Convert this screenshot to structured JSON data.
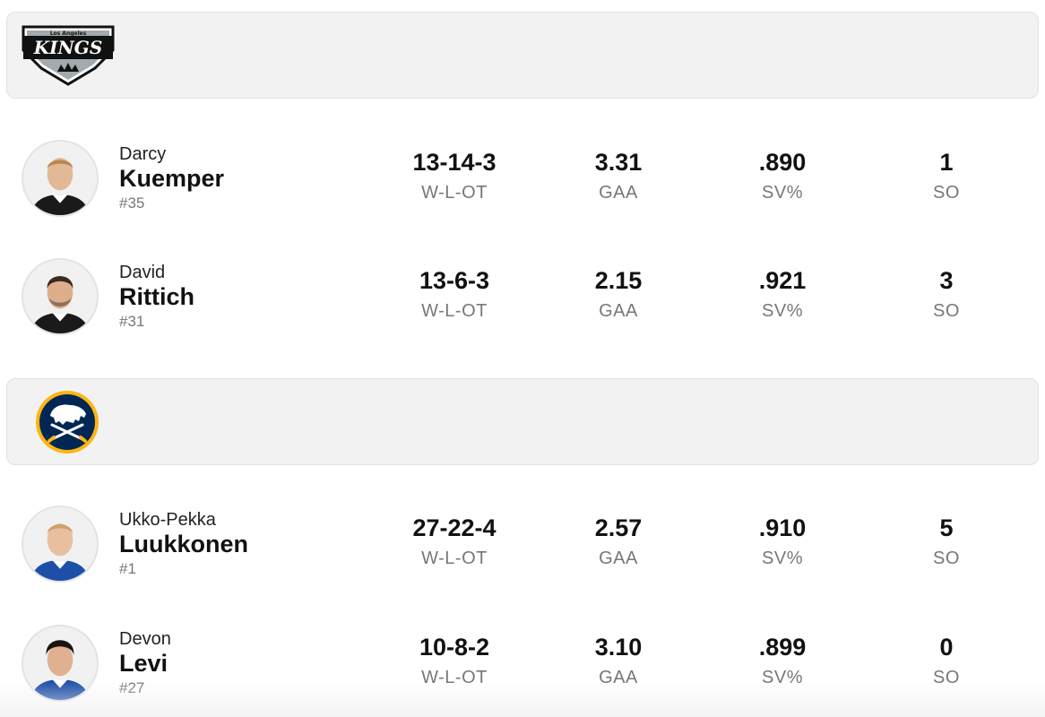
{
  "teams": [
    {
      "logo_icon": "kings-logo-icon",
      "logo_text_small": "Los Angeles",
      "logo_text": "KINGS",
      "players": [
        {
          "first": "Darcy",
          "last": "Kuemper",
          "number": "#35",
          "record": "13-14-3",
          "gaa": "3.31",
          "sv": ".890",
          "so": "1",
          "jersey": "#1a1a1a",
          "hair": "#b8894e"
        },
        {
          "first": "David",
          "last": "Rittich",
          "number": "#31",
          "record": "13-6-3",
          "gaa": "2.15",
          "sv": ".921",
          "so": "3",
          "jersey": "#1a1a1a",
          "hair": "#3a2a1f"
        }
      ]
    },
    {
      "logo_icon": "sabres-logo-icon",
      "players": [
        {
          "first": "Ukko-Pekka",
          "last": "Luukkonen",
          "number": "#1",
          "record": "27-22-4",
          "gaa": "2.57",
          "sv": ".910",
          "so": "5",
          "jersey": "#1e4fa8",
          "hair": "#c9a36a"
        },
        {
          "first": "Devon",
          "last": "Levi",
          "number": "#27",
          "record": "10-8-2",
          "gaa": "3.10",
          "sv": ".899",
          "so": "0",
          "jersey": "#1e4fa8",
          "hair": "#1a1410"
        }
      ]
    }
  ],
  "labels": {
    "record": "W-L-OT",
    "gaa": "GAA",
    "sv": "SV%",
    "so": "SO"
  },
  "colors": {
    "kings_black": "#111111",
    "kings_silver": "#a2aaad",
    "sabres_navy": "#002654",
    "sabres_gold": "#fcb514",
    "header_bg": "#f2f2f2"
  }
}
